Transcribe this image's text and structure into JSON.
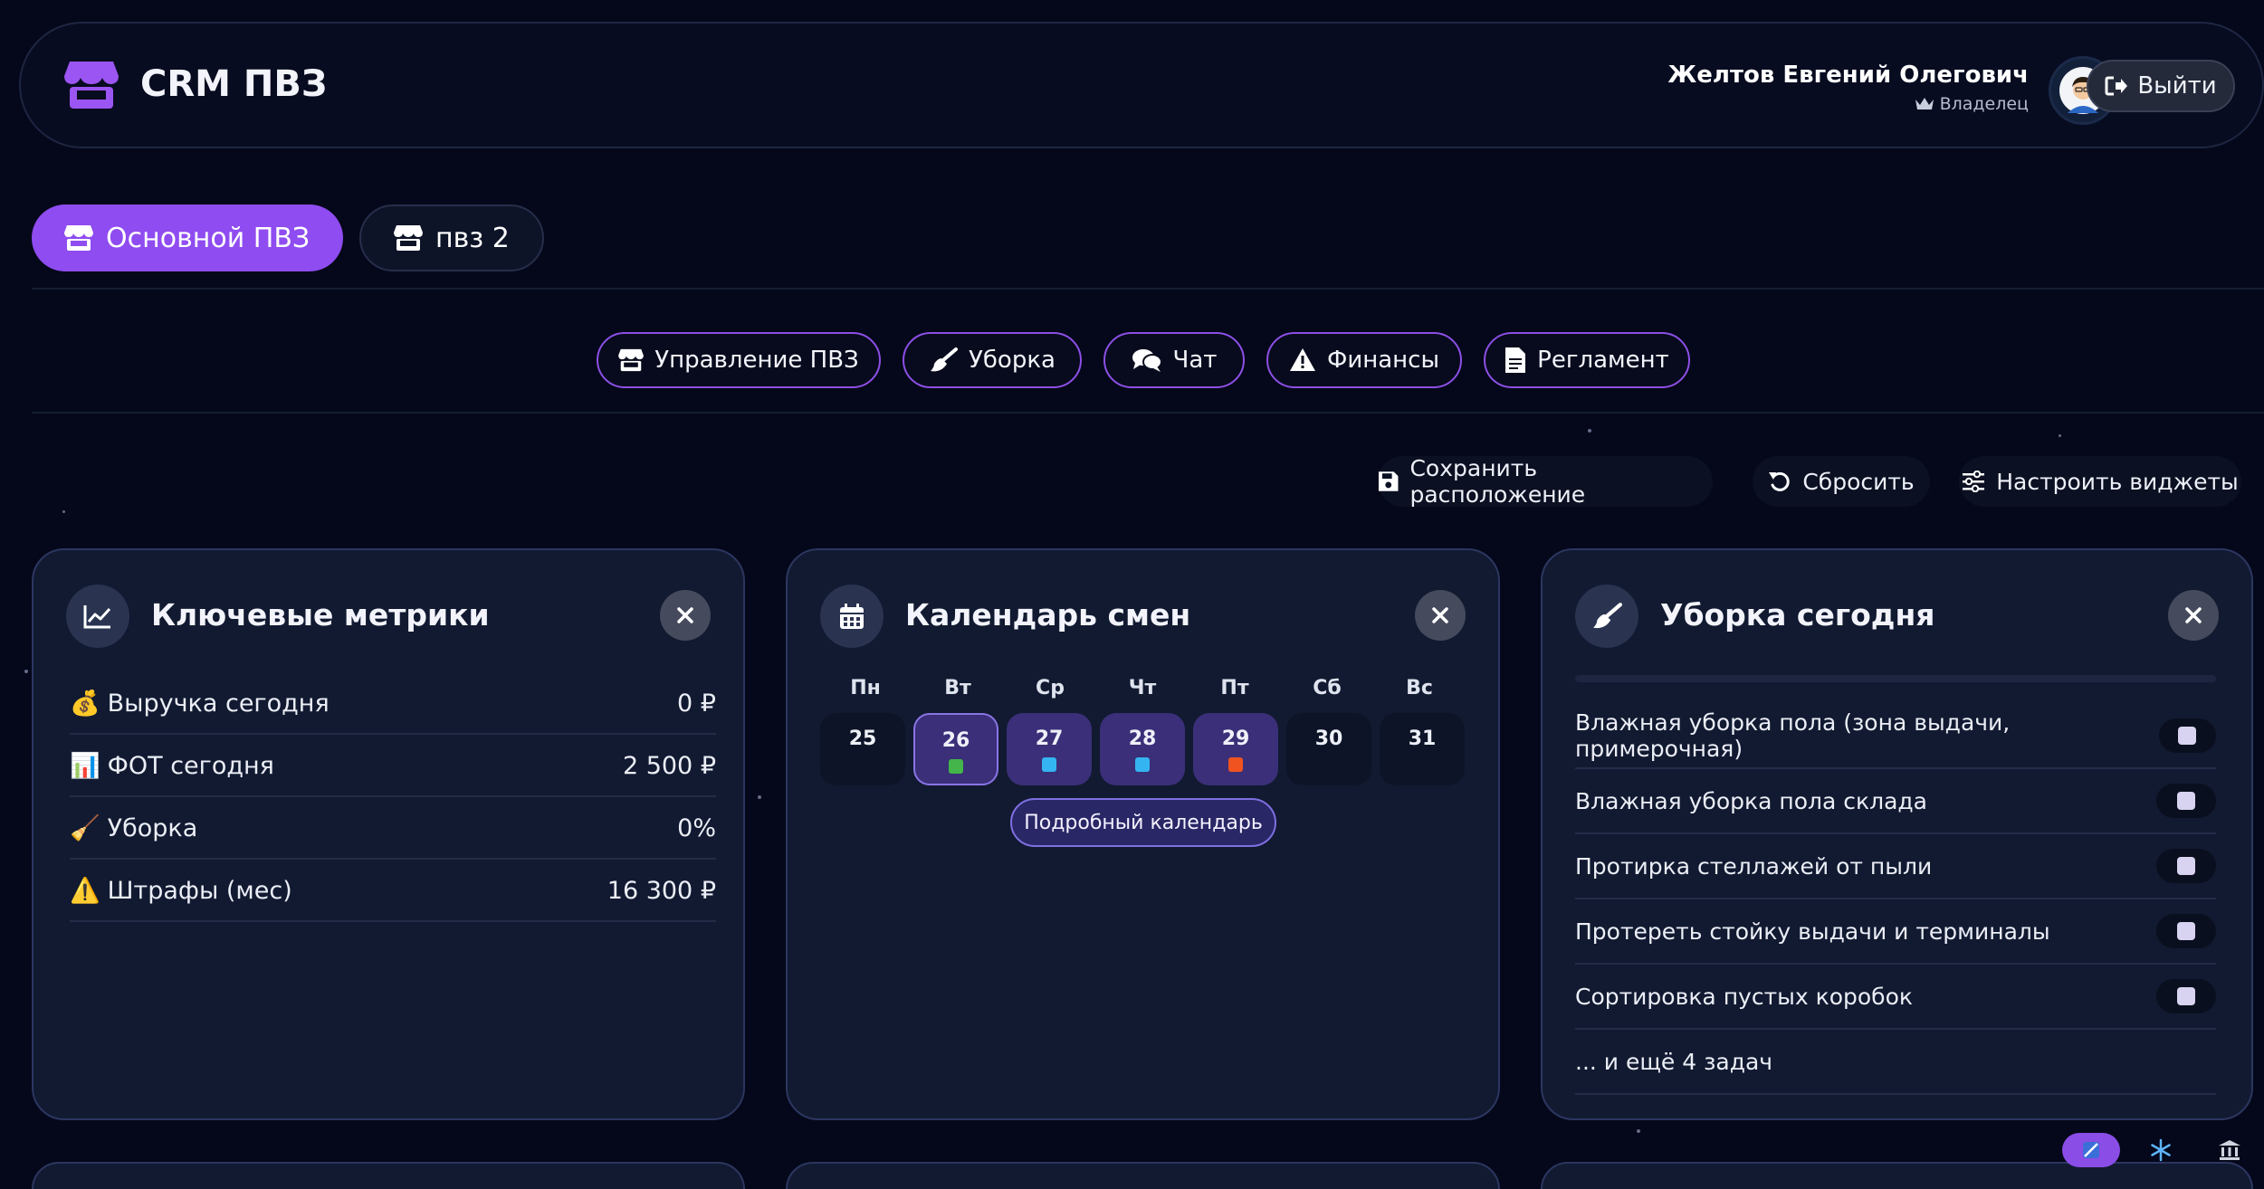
{
  "header": {
    "app_title": "CRM ПВЗ",
    "user_name": "Желтов Евгений Олегович",
    "user_role": "Владелец",
    "logout_label": "Выйти"
  },
  "pvz_tabs": [
    {
      "label": "Основной ПВЗ",
      "active": true
    },
    {
      "label": "пвз 2",
      "active": false
    }
  ],
  "nav": [
    {
      "label": "Управление ПВЗ",
      "icon": "store-icon"
    },
    {
      "label": "Уборка",
      "icon": "broom-icon"
    },
    {
      "label": "Чат",
      "icon": "chat-icon"
    },
    {
      "label": "Финансы",
      "icon": "warning-icon"
    },
    {
      "label": "Регламент",
      "icon": "document-icon"
    }
  ],
  "toolbar": {
    "save_label": "Сохранить расположение",
    "reset_label": "Сбросить",
    "configure_label": "Настроить виджеты"
  },
  "widgets": {
    "metrics": {
      "title": "Ключевые метрики",
      "rows": [
        {
          "emoji": "💰",
          "label": "Выручка сегодня",
          "value": "0 ₽"
        },
        {
          "emoji": "📊",
          "label": "ФОТ сегодня",
          "value": "2 500 ₽"
        },
        {
          "emoji": "🧹",
          "label": "Уборка",
          "value": "0%"
        },
        {
          "emoji": "⚠️",
          "label": "Штрафы (мес)",
          "value": "16 300 ₽"
        }
      ]
    },
    "calendar": {
      "title": "Календарь смен",
      "weekdays": [
        "Пн",
        "Вт",
        "Ср",
        "Чт",
        "Пт",
        "Сб",
        "Вс"
      ],
      "days": [
        {
          "day": "25",
          "selected": false,
          "today": false,
          "dot": ""
        },
        {
          "day": "26",
          "selected": true,
          "today": true,
          "dot": "#43b54a"
        },
        {
          "day": "27",
          "selected": true,
          "today": false,
          "dot": "#34b4f0"
        },
        {
          "day": "28",
          "selected": true,
          "today": false,
          "dot": "#34b4f0"
        },
        {
          "day": "29",
          "selected": true,
          "today": false,
          "dot": "#f0531f"
        },
        {
          "day": "30",
          "selected": false,
          "today": false,
          "dot": ""
        },
        {
          "day": "31",
          "selected": false,
          "today": false,
          "dot": ""
        }
      ],
      "details_label": "Подробный календарь"
    },
    "cleaning": {
      "title": "Уборка сегодня",
      "tasks": [
        "Влажная уборка пола (зона выдачи, примерочная)",
        "Влажная уборка пола склада",
        "Протирка стеллажей от пыли",
        "Протереть стойку выдачи и терминалы",
        "Сортировка пустых коробок"
      ],
      "more_label": "... и ещё 4 задач"
    }
  },
  "colors": {
    "accent": "#8f4cf0",
    "background": "#04081a",
    "card": "#111a31"
  }
}
